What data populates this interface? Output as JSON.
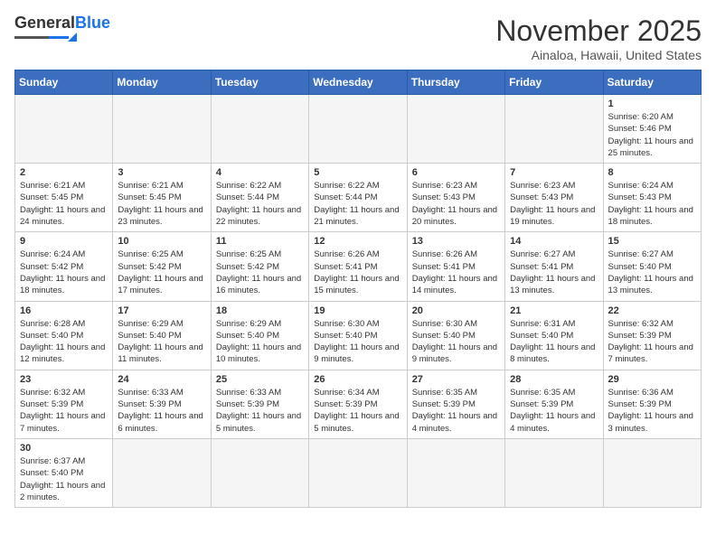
{
  "header": {
    "logo_general": "General",
    "logo_blue": "Blue",
    "month_title": "November 2025",
    "location": "Ainaloa, Hawaii, United States"
  },
  "weekdays": [
    "Sunday",
    "Monday",
    "Tuesday",
    "Wednesday",
    "Thursday",
    "Friday",
    "Saturday"
  ],
  "days": [
    {
      "date": null,
      "empty": true
    },
    {
      "date": null,
      "empty": true
    },
    {
      "date": null,
      "empty": true
    },
    {
      "date": null,
      "empty": true
    },
    {
      "date": null,
      "empty": true
    },
    {
      "date": null,
      "empty": true
    },
    {
      "date": 1,
      "sunrise": "6:20 AM",
      "sunset": "5:46 PM",
      "daylight": "11 hours and 25 minutes."
    },
    {
      "date": 2,
      "sunrise": "6:21 AM",
      "sunset": "5:45 PM",
      "daylight": "11 hours and 24 minutes."
    },
    {
      "date": 3,
      "sunrise": "6:21 AM",
      "sunset": "5:45 PM",
      "daylight": "11 hours and 23 minutes."
    },
    {
      "date": 4,
      "sunrise": "6:22 AM",
      "sunset": "5:44 PM",
      "daylight": "11 hours and 22 minutes."
    },
    {
      "date": 5,
      "sunrise": "6:22 AM",
      "sunset": "5:44 PM",
      "daylight": "11 hours and 21 minutes."
    },
    {
      "date": 6,
      "sunrise": "6:23 AM",
      "sunset": "5:43 PM",
      "daylight": "11 hours and 20 minutes."
    },
    {
      "date": 7,
      "sunrise": "6:23 AM",
      "sunset": "5:43 PM",
      "daylight": "11 hours and 19 minutes."
    },
    {
      "date": 8,
      "sunrise": "6:24 AM",
      "sunset": "5:43 PM",
      "daylight": "11 hours and 18 minutes."
    },
    {
      "date": 9,
      "sunrise": "6:24 AM",
      "sunset": "5:42 PM",
      "daylight": "11 hours and 18 minutes."
    },
    {
      "date": 10,
      "sunrise": "6:25 AM",
      "sunset": "5:42 PM",
      "daylight": "11 hours and 17 minutes."
    },
    {
      "date": 11,
      "sunrise": "6:25 AM",
      "sunset": "5:42 PM",
      "daylight": "11 hours and 16 minutes."
    },
    {
      "date": 12,
      "sunrise": "6:26 AM",
      "sunset": "5:41 PM",
      "daylight": "11 hours and 15 minutes."
    },
    {
      "date": 13,
      "sunrise": "6:26 AM",
      "sunset": "5:41 PM",
      "daylight": "11 hours and 14 minutes."
    },
    {
      "date": 14,
      "sunrise": "6:27 AM",
      "sunset": "5:41 PM",
      "daylight": "11 hours and 13 minutes."
    },
    {
      "date": 15,
      "sunrise": "6:27 AM",
      "sunset": "5:40 PM",
      "daylight": "11 hours and 13 minutes."
    },
    {
      "date": 16,
      "sunrise": "6:28 AM",
      "sunset": "5:40 PM",
      "daylight": "11 hours and 12 minutes."
    },
    {
      "date": 17,
      "sunrise": "6:29 AM",
      "sunset": "5:40 PM",
      "daylight": "11 hours and 11 minutes."
    },
    {
      "date": 18,
      "sunrise": "6:29 AM",
      "sunset": "5:40 PM",
      "daylight": "11 hours and 10 minutes."
    },
    {
      "date": 19,
      "sunrise": "6:30 AM",
      "sunset": "5:40 PM",
      "daylight": "11 hours and 9 minutes."
    },
    {
      "date": 20,
      "sunrise": "6:30 AM",
      "sunset": "5:40 PM",
      "daylight": "11 hours and 9 minutes."
    },
    {
      "date": 21,
      "sunrise": "6:31 AM",
      "sunset": "5:40 PM",
      "daylight": "11 hours and 8 minutes."
    },
    {
      "date": 22,
      "sunrise": "6:32 AM",
      "sunset": "5:39 PM",
      "daylight": "11 hours and 7 minutes."
    },
    {
      "date": 23,
      "sunrise": "6:32 AM",
      "sunset": "5:39 PM",
      "daylight": "11 hours and 7 minutes."
    },
    {
      "date": 24,
      "sunrise": "6:33 AM",
      "sunset": "5:39 PM",
      "daylight": "11 hours and 6 minutes."
    },
    {
      "date": 25,
      "sunrise": "6:33 AM",
      "sunset": "5:39 PM",
      "daylight": "11 hours and 5 minutes."
    },
    {
      "date": 26,
      "sunrise": "6:34 AM",
      "sunset": "5:39 PM",
      "daylight": "11 hours and 5 minutes."
    },
    {
      "date": 27,
      "sunrise": "6:35 AM",
      "sunset": "5:39 PM",
      "daylight": "11 hours and 4 minutes."
    },
    {
      "date": 28,
      "sunrise": "6:35 AM",
      "sunset": "5:39 PM",
      "daylight": "11 hours and 4 minutes."
    },
    {
      "date": 29,
      "sunrise": "6:36 AM",
      "sunset": "5:39 PM",
      "daylight": "11 hours and 3 minutes."
    },
    {
      "date": 30,
      "sunrise": "6:37 AM",
      "sunset": "5:40 PM",
      "daylight": "11 hours and 2 minutes."
    },
    {
      "date": null,
      "empty": true
    },
    {
      "date": null,
      "empty": true
    },
    {
      "date": null,
      "empty": true
    },
    {
      "date": null,
      "empty": true
    },
    {
      "date": null,
      "empty": true
    },
    {
      "date": null,
      "empty": true
    }
  ],
  "labels": {
    "sunrise": "Sunrise:",
    "sunset": "Sunset:",
    "daylight": "Daylight:"
  }
}
